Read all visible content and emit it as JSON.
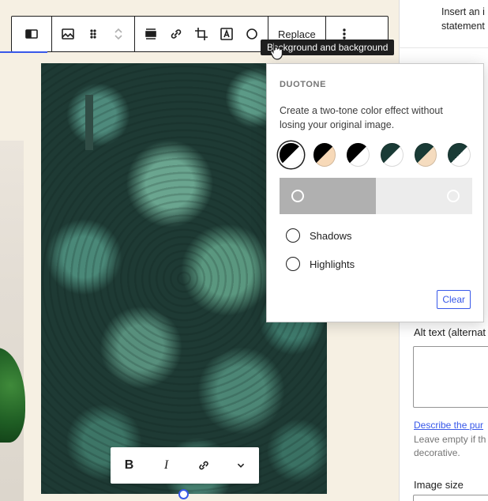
{
  "toolbar": {
    "replace_label": "Replace",
    "tooltip": "Background and background",
    "icons": [
      "sidebar-toggle-icon",
      "image-icon",
      "drag-handle-icon",
      "move-up-down-icon",
      "align-icon",
      "link-icon",
      "crop-icon",
      "text-overlay-icon",
      "duotone-icon",
      "more-options-icon"
    ]
  },
  "duotone": {
    "heading": "DUOTONE",
    "description": "Create a two-tone color effect without losing your original image.",
    "presets": [
      {
        "name": "dark-grayscale",
        "dark": "#000000",
        "light": "#ffffff",
        "selected": true
      },
      {
        "name": "black-beige",
        "dark": "#000000",
        "light": "#f7d9b8"
      },
      {
        "name": "black-white",
        "dark": "#000000",
        "light": "#ffffff"
      },
      {
        "name": "teal-white",
        "dark": "#1a3b36",
        "light": "#ffffff"
      },
      {
        "name": "teal-beige",
        "dark": "#1a3b36",
        "light": "#f5dcbf"
      },
      {
        "name": "teal-white-2",
        "dark": "#1a3b36",
        "light": "#ffffff"
      }
    ],
    "shadows_label": "Shadows",
    "highlights_label": "Highlights",
    "clear_label": "Clear",
    "gradient_colors": [
      "#b0b0b0",
      "#ececec"
    ]
  },
  "sidebar": {
    "top_text_1": "Insert an i",
    "top_text_2": "statement",
    "alt_label": "Alt text (alternat",
    "describe_link": "Describe the pur",
    "help_1": "Leave empty if th",
    "help_2": "decorative.",
    "image_size_label": "Image size"
  },
  "inline_toolbar": {
    "bold": "B",
    "italic": "I"
  },
  "colors": {
    "accent": "#3858e9",
    "editor_bg": "#f6f0e3"
  }
}
